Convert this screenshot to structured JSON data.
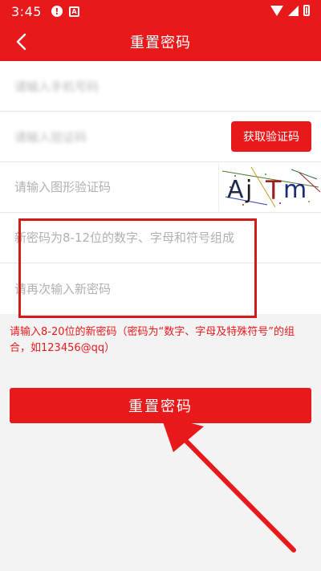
{
  "status_bar": {
    "time": "3:45",
    "icons": [
      "alert-icon",
      "a-badge-icon",
      "wifi-icon",
      "signal-icon",
      "battery-icon"
    ]
  },
  "header": {
    "title": "重置密码",
    "back_icon": "back-chevron-icon"
  },
  "form": {
    "phone_placeholder": "请输入手机号码",
    "sms_placeholder": "请输入验证码",
    "get_code_label": "获取验证码",
    "captcha_placeholder": "请输入图形验证码",
    "captcha_text": "AjTm",
    "new_password_placeholder": "新密码为8-12位的数字、字母和符号组成",
    "confirm_password_placeholder": "请再次输入新密码"
  },
  "hint": "请输入8-20位的新密码（密码为“数字、字母及特殊符号”的组合，如123456@qq）",
  "submit_label": "重置密码",
  "colors": {
    "brand": "#e8191b",
    "background": "#f3f3f3",
    "placeholder": "#b0b0b0"
  }
}
